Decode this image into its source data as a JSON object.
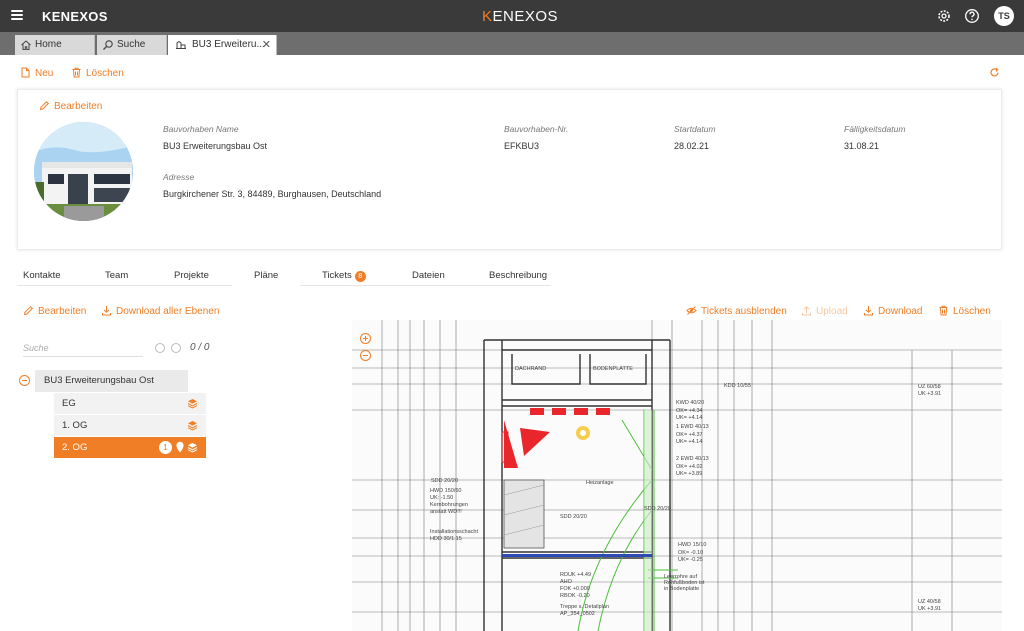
{
  "topbar": {
    "app_title": "KENEXOS",
    "logo_k": "K",
    "logo_rest": "ENEXOS",
    "user_initials": "TS"
  },
  "tabs": [
    {
      "label": "Home"
    },
    {
      "label": "Suche"
    },
    {
      "label": "BU3 Erweiteru..."
    }
  ],
  "toolbar": {
    "new_label": "Neu",
    "delete_label": "Löschen"
  },
  "card": {
    "edit_label": "Bearbeiten",
    "fields": {
      "name_label": "Bauvorhaben Name",
      "name_value": "BU3 Erweiterungsbau Ost",
      "nr_label": "Bauvorhaben-Nr.",
      "nr_value": "EFKBU3",
      "start_label": "Startdatum",
      "start_value": "28.02.21",
      "due_label": "Fälligkeitsdatum",
      "due_value": "31.08.21",
      "address_label": "Adresse",
      "address_value": "Burgkirchener Str. 3, 84489, Burghausen, Deutschland"
    }
  },
  "project_tabs": [
    {
      "label": "Kontakte"
    },
    {
      "label": "Team"
    },
    {
      "label": "Projekte"
    },
    {
      "label": "Pläne"
    },
    {
      "label": "Tickets",
      "badge": "8"
    },
    {
      "label": "Dateien"
    },
    {
      "label": "Beschreibung"
    }
  ],
  "plans": {
    "edit_label": "Bearbeiten",
    "download_all_label": "Download aller Ebenen",
    "hide_tickets_label": "Tickets ausblenden",
    "upload_label": "Upload",
    "download_label": "Download",
    "delete_label": "Löschen",
    "search_placeholder": "Suche",
    "counter": "0 / 0",
    "tree_root": "BU3 Erweiterungsbau Ost",
    "levels": [
      {
        "label": "EG"
      },
      {
        "label": "1. OG"
      },
      {
        "label": "2. OG",
        "badge": "1",
        "selected": true
      }
    ]
  },
  "drawing": {
    "labels": [
      "SDD 20/20",
      "HWD 150/60",
      "UK: -1.50",
      "Kernbohrungen",
      "anstatt WD!!!",
      "Installationsschacht",
      "HDD 30/1.15",
      "Heizanlage",
      "SDD 20/20",
      "SDD 20/20",
      "KWD 40/20",
      "OK= +4.34",
      "UK= +4.14",
      "1 EWD 40/13",
      "OK= +4.37",
      "UK= +4.14",
      "2 EWD 40/13",
      "OK= +4.02",
      "UK= +3.89",
      "HWD 15/10",
      "OK= -0.10",
      "UK= -0.25",
      "UZ 60/58",
      "UK +3.91",
      "UZ 40/58",
      "UK +3.91",
      "KDD 10/55",
      "RDUK +4.49",
      "AHO",
      "FOK +0.000",
      "RBOK -0.20",
      "Treppe s. Detailplan",
      "AP_354_0502",
      "DACHRAND",
      "BODENPLATTE",
      "Leerrohre auf",
      "Rohfußboden ist",
      "in Bodenplatte"
    ]
  },
  "colors": {
    "accent": "#f07e26",
    "topbar": "#3a3a3a",
    "tabbar": "#6e6e6e"
  }
}
